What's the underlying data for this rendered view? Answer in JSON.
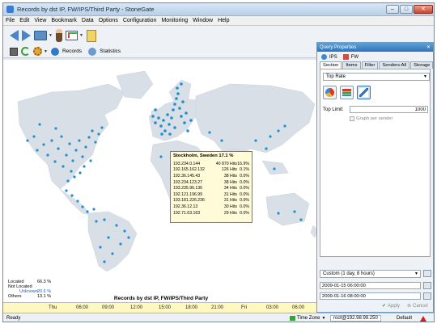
{
  "window": {
    "title": "Records by dst IP, FW/IPS/Third Party - StoneGate"
  },
  "menu": [
    "File",
    "Edit",
    "View",
    "Bookmark",
    "Data",
    "Options",
    "Configuration",
    "Monitoring",
    "Window",
    "Help"
  ],
  "toolbar2": {
    "records_label": "Records",
    "statistics_label": "Statistics"
  },
  "tooltip": {
    "title": "Stockholm, Sweden 17.1 %",
    "rows": [
      {
        "ip": "193.234.0.144",
        "hits": "40 870 Hits",
        "pct": "16.9%"
      },
      {
        "ip": "192.165.162.132",
        "hits": "126 Hits",
        "pct": "0.1%"
      },
      {
        "ip": "192.36.145.43",
        "hits": "38 Hits",
        "pct": "0.0%"
      },
      {
        "ip": "193.234.123.27",
        "hits": "38 Hits",
        "pct": "0.0%"
      },
      {
        "ip": "193.235.96.136",
        "hits": "34 Hits",
        "pct": "0.0%"
      },
      {
        "ip": "192.121.196.99",
        "hits": "31 Hits",
        "pct": "0.0%"
      },
      {
        "ip": "193.181.226.236",
        "hits": "31 Hits",
        "pct": "0.0%"
      },
      {
        "ip": "192.36.12.13",
        "hits": "30 Hits",
        "pct": "0.0%"
      },
      {
        "ip": "192.71.63.163",
        "hits": "29 Hits",
        "pct": "0.0%"
      }
    ]
  },
  "legend": {
    "located_label": "Located",
    "located_value": "66.3 %",
    "not_located_label": "Not Located",
    "unknown_label": "Unknown",
    "unknown_value": "20.6 %",
    "others_label": "Others",
    "others_value": "13.1 %"
  },
  "chart_title": "Records by dst IP, FW/IPS/Third Party",
  "timeline": [
    "Thu",
    "06:00",
    "09:00",
    "12:00",
    "15:00",
    "18:00",
    "21:00",
    "Fri",
    "03:00",
    "06:00"
  ],
  "panel": {
    "title": "Query Properties",
    "ips_label": "IPS",
    "fw_label": "FW",
    "tabs": [
      "Section",
      "Items",
      "Filter",
      "Senders:All",
      "Storage"
    ],
    "section_select": "Top Rate",
    "top_limit_label": "Top Limit:",
    "top_limit_value": "1000",
    "graph_per_sender": "Graph per sender",
    "time_range": "Custom (1 day, 8 hours)",
    "start_time": "2009-01-15 06:00:00",
    "end_time": "2009-01-16 08:00:00",
    "apply_label": "Apply",
    "cancel_label": "Cancel"
  },
  "status": {
    "ready": "Ready",
    "time_zone": "Time Zone",
    "user": "root@192.98.99.250",
    "workspace": "Default"
  },
  "colors": {
    "map_dot": "#1f8fd0",
    "tooltip_bg": "#fffbd8",
    "timeline_bg": "#fff8c0"
  }
}
